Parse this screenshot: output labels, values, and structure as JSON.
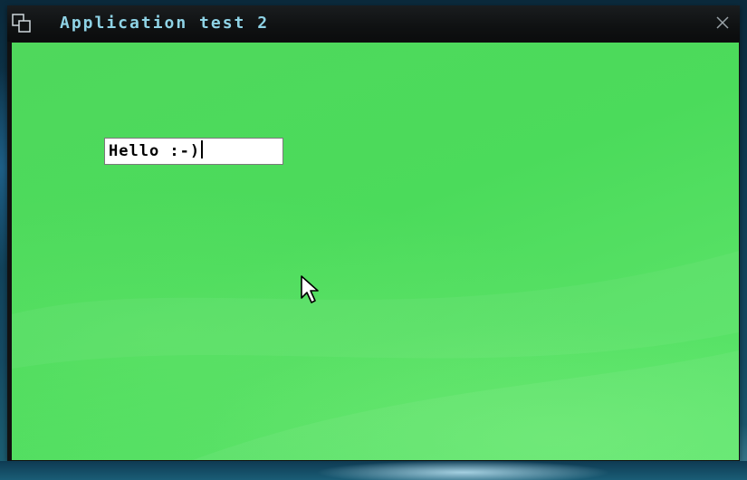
{
  "window": {
    "title": "Application test 2",
    "icon": "window-restore-icon",
    "close_icon": "close-icon"
  },
  "text_field": {
    "value": "Hello :-)"
  },
  "colors": {
    "client_background": "#4fd85c",
    "title_text": "#8fd3e6",
    "titlebar": "#0f1112"
  },
  "cursor": {
    "icon": "mouse-pointer-icon"
  }
}
